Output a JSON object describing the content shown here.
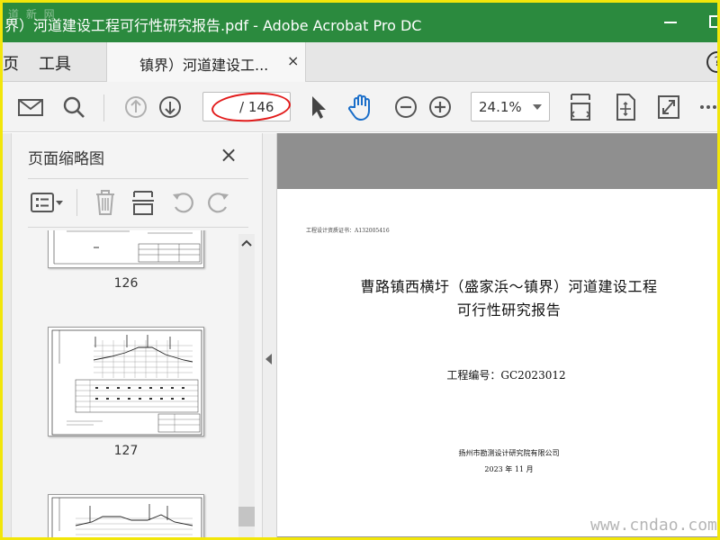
{
  "window": {
    "title": "界）河道建设工程可行性研究报告.pdf - Adobe Acrobat Pro DC",
    "watermark_top": "道 新 网"
  },
  "tabs": {
    "home_cut": "页",
    "tools": "工具",
    "document": "镇界）河道建设工...",
    "close": "×",
    "help": "?"
  },
  "toolbar": {
    "icons": [
      "mail-icon",
      "search-icon",
      "prev-page-icon",
      "next-page-icon",
      "select-arrow-icon",
      "hand-tool-icon",
      "zoom-out-icon",
      "zoom-in-icon",
      "fit-width-icon",
      "rotate-view-icon",
      "fullscreen-icon",
      "more-icon"
    ],
    "page_current": "",
    "page_total": "/ 146",
    "zoom": "24.1%"
  },
  "panel": {
    "title": "页面缩略图",
    "close": "×",
    "tools": [
      "options-icon",
      "delete-icon",
      "extract-icon",
      "rotate-ccw-icon",
      "rotate-cw-icon"
    ],
    "thumbnails": [
      {
        "label": "126"
      },
      {
        "label": "127"
      }
    ]
  },
  "document": {
    "cert": "工程设计资质证书：A132005416",
    "title_line1": "曹路镇西横圩（盛家浜～镇界）河道建设工程",
    "title_line2": "可行性研究报告",
    "project_no": "工程编号：GC2023012",
    "institute": "扬州市勘测设计研究院有限公司",
    "date": "2023 年 11 月"
  },
  "watermark": "www.cndao.com",
  "colors": {
    "titlebar": "#2b8a3e",
    "frame": "#f2e60a",
    "annotation": "#e21b1b",
    "hand_tool": "#1a6ec9"
  }
}
